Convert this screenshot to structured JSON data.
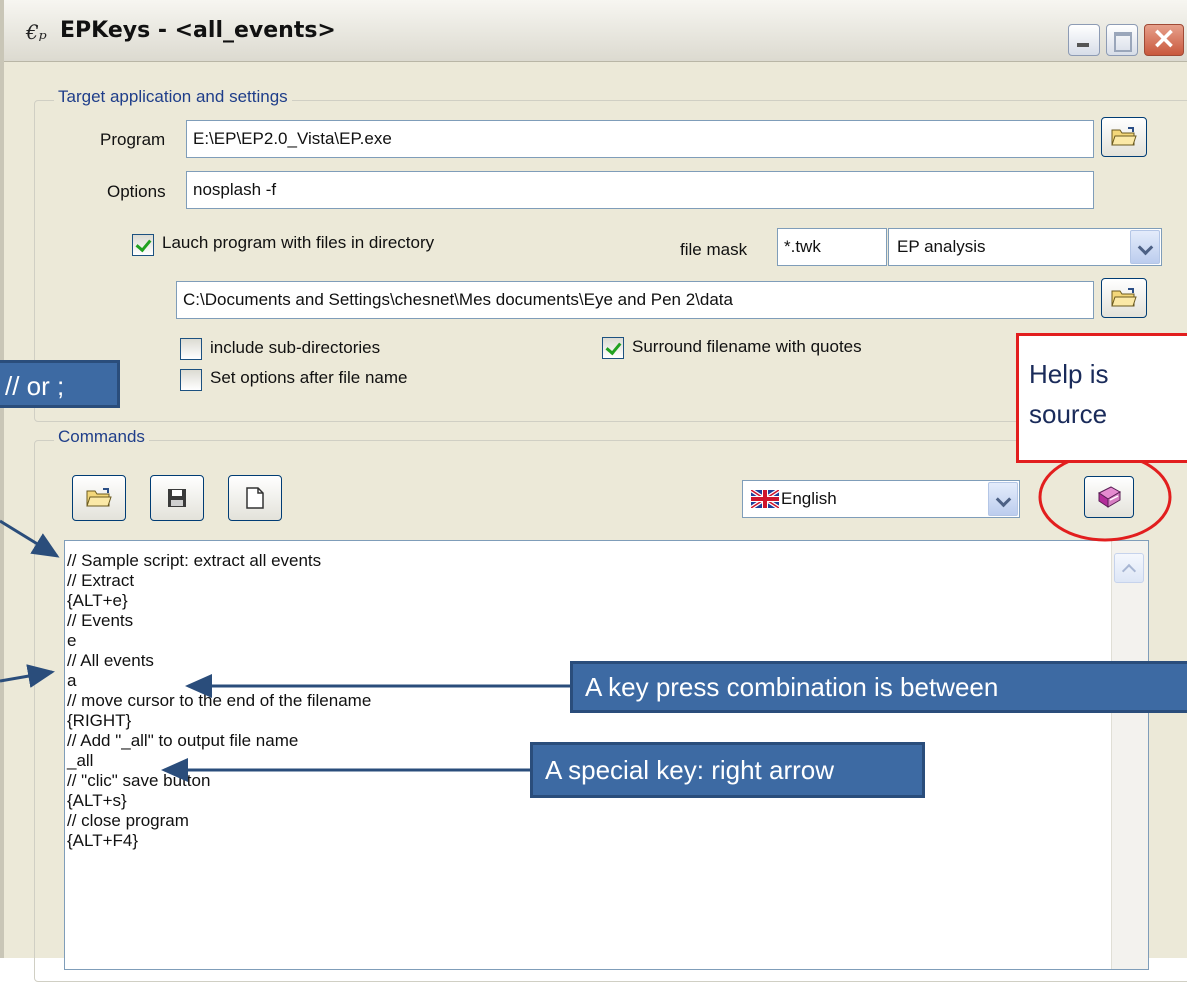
{
  "window": {
    "icon_glyph": "€ₚ",
    "title": "EPKeys - <all_events>"
  },
  "target_group": {
    "legend": "Target application and settings",
    "program_label": "Program",
    "program_value": "E:\\EP\\EP2.0_Vista\\EP.exe",
    "options_label": "Options",
    "options_value": "nosplash -f",
    "launch_checkbox_label": "Lauch program with files in directory",
    "launch_checked": true,
    "file_mask_label": "file mask",
    "file_mask_value": "*.twk",
    "file_type_selected": "EP analysis",
    "directory_value": "C:\\Documents and Settings\\chesnet\\Mes documents\\Eye and Pen 2\\data",
    "include_subdirs_label": "include sub-directories",
    "include_subdirs_checked": false,
    "set_options_label": "Set options after file name",
    "set_options_checked": false,
    "surround_quotes_label": "Surround filename with quotes",
    "surround_quotes_checked": true
  },
  "commands_group": {
    "legend": "Commands",
    "language_selected": "English",
    "script_lines": [
      "// Sample script: extract all events",
      "// Extract",
      "{ALT+e}",
      "// Events",
      "e",
      "// All events",
      "a",
      "// move cursor to the end of the filename",
      "{RIGHT}",
      "// Add \"_all\" to output file name",
      "_all",
      "// \"clic\" save button",
      "{ALT+s}",
      "// close program",
      "{ALT+F4}"
    ]
  },
  "annotations": {
    "comment_marker": "// or ;",
    "key_combination": "A key press combination is between",
    "special_key": "A special key: right arrow",
    "help_line1": "Help is",
    "help_line2": "source"
  },
  "colors": {
    "callout_fill": "#3d6aa3",
    "arrow": "#2a4d7b",
    "help_highlight": "#e21e1e",
    "checkmark": "#21a121"
  }
}
